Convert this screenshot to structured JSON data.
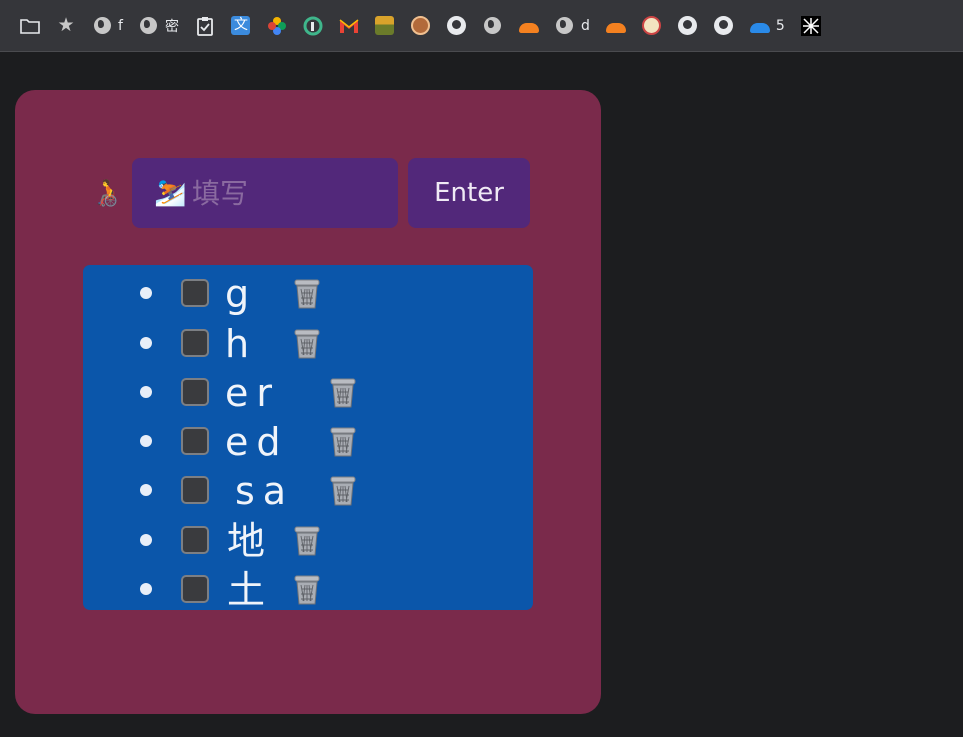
{
  "bookmarks": [
    {
      "icon": "folder-icon",
      "label": ""
    },
    {
      "icon": "star-icon",
      "label": ""
    },
    {
      "icon": "globe-icon",
      "label": "f"
    },
    {
      "icon": "globe-icon",
      "label": "密"
    },
    {
      "icon": "clipboard-check-icon",
      "label": ""
    },
    {
      "icon": "translate-icon",
      "label": ""
    },
    {
      "icon": "pinwheel-icon",
      "label": ""
    },
    {
      "icon": "green-circle-icon",
      "label": ""
    },
    {
      "icon": "gmail-icon",
      "label": ""
    },
    {
      "icon": "photo-icon",
      "label": ""
    },
    {
      "icon": "avatar-icon",
      "label": ""
    },
    {
      "icon": "github-icon",
      "label": ""
    },
    {
      "icon": "globe-icon",
      "label": ""
    },
    {
      "icon": "cloudflare-icon",
      "label": ""
    },
    {
      "icon": "globe-icon",
      "label": "d"
    },
    {
      "icon": "cloudflare-icon",
      "label": ""
    },
    {
      "icon": "sticker-icon",
      "label": ""
    },
    {
      "icon": "github-icon",
      "label": ""
    },
    {
      "icon": "github-icon",
      "label": ""
    },
    {
      "icon": "onedrive-icon",
      "label": "5"
    },
    {
      "icon": "pattern-icon",
      "label": ""
    }
  ],
  "todo": {
    "person_icon": "🧑‍🦽",
    "input_icon": "⛷️",
    "input_placeholder": "填写",
    "input_value": "",
    "enter_label": "Enter",
    "items": [
      {
        "text": "g",
        "done": false
      },
      {
        "text": "h",
        "done": false
      },
      {
        "text": "er",
        "done": false
      },
      {
        "text": "ed",
        "done": false
      },
      {
        "text": "sa",
        "done": false
      },
      {
        "text": "地",
        "done": false
      },
      {
        "text": "土",
        "done": false
      }
    ]
  },
  "colors": {
    "page_bg": "#1c1d1f",
    "card_bg": "#7a2a4b",
    "input_bg": "#52287a",
    "list_bg": "#0b56aa"
  }
}
